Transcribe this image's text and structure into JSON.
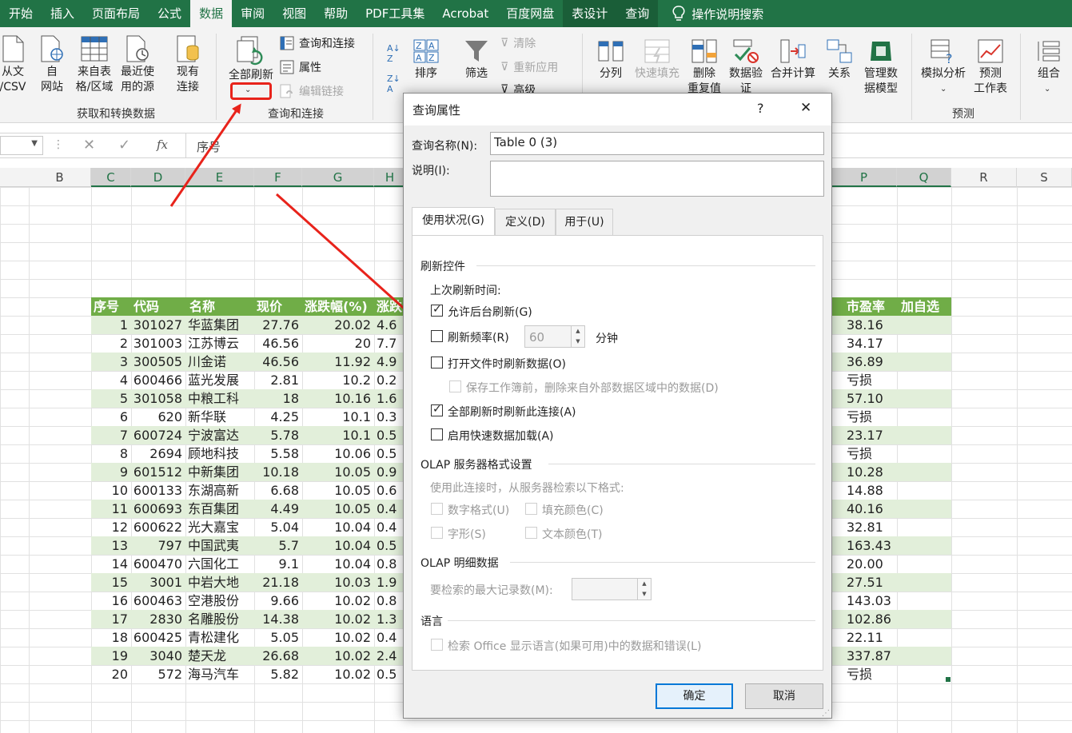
{
  "ribbon_tabs": [
    "开始",
    "插入",
    "页面布局",
    "公式",
    "数据",
    "审阅",
    "视图",
    "帮助",
    "PDF工具集",
    "Acrobat",
    "百度网盘",
    "表设计",
    "查询"
  ],
  "tell_me": "操作说明搜索",
  "ribbon": {
    "get_data": {
      "from_text": [
        "从文",
        "/CSV"
      ],
      "from_web": [
        "自",
        "网站"
      ],
      "from_table": [
        "来自表",
        "格/区域"
      ],
      "recent": [
        "最近使",
        "用的源"
      ],
      "existing": [
        "现有",
        "连接"
      ],
      "group_label": "获取和转换数据"
    },
    "queries": {
      "refresh_all": "全部刷新",
      "queries_connections": "查询和连接",
      "properties": "属性",
      "edit_links": "编辑链接",
      "group_label": "查询和连接"
    },
    "sort": {
      "sort": "排序",
      "filter": "筛选",
      "clear": "清除",
      "reapply": "重新应用",
      "advanced": "高级"
    },
    "tools": {
      "split": "分列",
      "flash_fill": "快速填充",
      "remove_dup": [
        "删除",
        "重复值"
      ],
      "validation": [
        "数据验",
        "证"
      ],
      "consolidate": "合并计算",
      "relations": "关系",
      "data_model": [
        "管理数",
        "据模型"
      ]
    },
    "forecast": {
      "whatif": "模拟分析",
      "sheet": [
        "预测",
        "工作表"
      ],
      "group_label": "预测"
    },
    "outline": {
      "group": "组合"
    }
  },
  "formula_bar": {
    "content": "序号",
    "fx": "fx"
  },
  "columns": [
    "B",
    "C",
    "D",
    "E",
    "F",
    "G",
    "H",
    "P",
    "Q",
    "R",
    "S"
  ],
  "table": {
    "headers": [
      "序号",
      "代码",
      "名称",
      "现价",
      "涨跌幅(%)",
      "涨跌",
      "市盈率",
      "加自选"
    ],
    "rows": [
      [
        "1",
        "301027",
        "华蓝集团",
        "27.76",
        "20.02",
        "4.6",
        "38.16"
      ],
      [
        "2",
        "301003",
        "江苏博云",
        "46.56",
        "20",
        "7.7",
        "34.17"
      ],
      [
        "3",
        "300505",
        "川金诺",
        "46.56",
        "11.92",
        "4.9",
        "36.89"
      ],
      [
        "4",
        "600466",
        "蓝光发展",
        "2.81",
        "10.2",
        "0.2",
        "亏损"
      ],
      [
        "5",
        "301058",
        "中粮工科",
        "18",
        "10.16",
        "1.6",
        "57.10"
      ],
      [
        "6",
        "620",
        "新华联",
        "4.25",
        "10.1",
        "0.3",
        "亏损"
      ],
      [
        "7",
        "600724",
        "宁波富达",
        "5.78",
        "10.1",
        "0.5",
        "23.17"
      ],
      [
        "8",
        "2694",
        "顾地科技",
        "5.58",
        "10.06",
        "0.5",
        "亏损"
      ],
      [
        "9",
        "601512",
        "中新集团",
        "10.18",
        "10.05",
        "0.9",
        "10.28"
      ],
      [
        "10",
        "600133",
        "东湖高新",
        "6.68",
        "10.05",
        "0.6",
        "14.88"
      ],
      [
        "11",
        "600693",
        "东百集团",
        "4.49",
        "10.05",
        "0.4",
        "40.16"
      ],
      [
        "12",
        "600622",
        "光大嘉宝",
        "5.04",
        "10.04",
        "0.4",
        "32.81"
      ],
      [
        "13",
        "797",
        "中国武夷",
        "5.7",
        "10.04",
        "0.5",
        "163.43"
      ],
      [
        "14",
        "600470",
        "六国化工",
        "9.1",
        "10.04",
        "0.8",
        "20.00"
      ],
      [
        "15",
        "3001",
        "中岩大地",
        "21.18",
        "10.03",
        "1.9",
        "27.51"
      ],
      [
        "16",
        "600463",
        "空港股份",
        "9.66",
        "10.02",
        "0.8",
        "143.03"
      ],
      [
        "17",
        "2830",
        "名雕股份",
        "14.38",
        "10.02",
        "1.3",
        "102.86"
      ],
      [
        "18",
        "600425",
        "青松建化",
        "5.05",
        "10.02",
        "0.4",
        "22.11"
      ],
      [
        "19",
        "3040",
        "楚天龙",
        "26.68",
        "10.02",
        "2.4",
        "337.87"
      ],
      [
        "20",
        "572",
        "海马汽车",
        "5.82",
        "10.02",
        "0.5",
        "亏损"
      ]
    ]
  },
  "dialog": {
    "title": "查询属性",
    "help": "?",
    "close": "✕",
    "name_label": "查询名称(N):",
    "name_value": "Table 0 (3)",
    "desc_label": "说明(I):",
    "tabs": [
      "使用状况(G)",
      "定义(D)",
      "用于(U)"
    ],
    "refresh_section": "刷新控件",
    "last_refresh": "上次刷新时间:",
    "bg_refresh": "允许后台刷新(G)",
    "refresh_every": "刷新频率(R)",
    "refresh_minutes": "60",
    "minutes_unit": "分钟",
    "refresh_on_open": "打开文件时刷新数据(O)",
    "remove_before_save": "保存工作簿前，删除来自外部数据区域中的数据(D)",
    "refresh_all": "全部刷新时刷新此连接(A)",
    "fast_load": "启用快速数据加载(A)",
    "olap_format_section": "OLAP 服务器格式设置",
    "olap_format_hint": "使用此连接时，从服务器检索以下格式:",
    "number_format": "数字格式(U)",
    "fill_color": "填充颜色(C)",
    "font_style": "字形(S)",
    "text_color": "文本颜色(T)",
    "olap_drill_section": "OLAP 明细数据",
    "max_records": "要检索的最大记录数(M):",
    "language_section": "语言",
    "language_option": "检索 Office 显示语言(如果可用)中的数据和错误(L)",
    "ok": "确定",
    "cancel": "取消"
  },
  "colors": {
    "excel_green": "#217346",
    "table_header": "#70ad47",
    "table_band": "#e2efda",
    "annotation_red": "#e8231b"
  }
}
